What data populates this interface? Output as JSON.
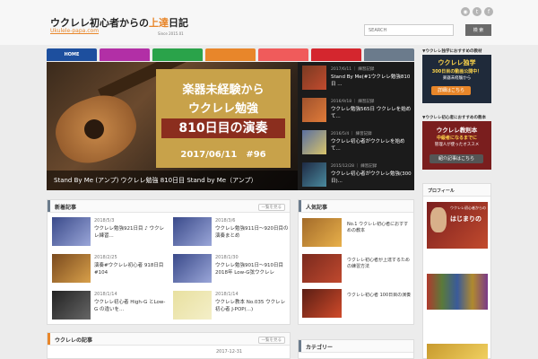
{
  "site": {
    "title_pre": "ウクレレ初心者からの",
    "title_accent": "上達",
    "title_post": "日記",
    "subtitle": "Ukulele-papa.com",
    "since": "Since 2015.01"
  },
  "social_icons": [
    "rss-icon",
    "twitter-icon",
    "facebook-icon"
  ],
  "search": {
    "placeholder": "SEARCH",
    "button": "検 索"
  },
  "nav": [
    {
      "label": "HOME",
      "color": "#1d4f9e"
    },
    {
      "label": "",
      "color": "#b22fa6"
    },
    {
      "label": "",
      "color": "#2aa34a"
    },
    {
      "label": "",
      "color": "#e8862a"
    },
    {
      "label": "",
      "color": "#f05b5b"
    },
    {
      "label": "",
      "color": "#d4262e"
    },
    {
      "label": "",
      "color": "#6b7b8c"
    }
  ],
  "hero": {
    "line1": "楽器未経験から",
    "line2": "ウクレレ勉強",
    "line3": "810日目の演奏",
    "line4": "2017/06/11　#96",
    "caption": "Stand By Me (アンプ) ウクレレ勉強 810日目 Stand by Me（アンプ）",
    "list": [
      {
        "date": "2017/6/11 ｜ 練習記録",
        "title": "Stand By Me(#1ウクレレ勉強810日 ..."
      },
      {
        "date": "2016/9/18 ｜ 練習記録",
        "title": "ウクレレ勉強565日 ウクレレを始めて..."
      },
      {
        "date": "2016/5/4 ｜ 練習記録",
        "title": "ウクレレ初心者がウクレレを始めて..."
      },
      {
        "date": "2015/12/28 ｜ 練習記録",
        "title": "ウクレレ初心者がウクレレ勉強(300日)..."
      }
    ]
  },
  "new_posts": {
    "title": "新着記事",
    "more": "一覧を見る",
    "items": [
      {
        "date": "2018/5/3",
        "title": "ウクレレ勉強921日目 ♪ ウクレレ練習..."
      },
      {
        "date": "2018/3/6",
        "title": "ウクレレ勉強911日～920日目の演奏まとめ"
      },
      {
        "date": "2018/2/25",
        "title": "演奏#ウクレレ初心者 918日目 #104"
      },
      {
        "date": "2018/1/30",
        "title": "ウクレレ勉強901日～910日目 2018年 Low-G弦ウクレレ"
      },
      {
        "date": "2018/1/14",
        "title": "ウクレレ初心者 High-G とLow-G の違いを..."
      },
      {
        "date": "2018/1/14",
        "title": "ウクレレ教本 No.035 ウクレレ初心者 J-POP(...)"
      }
    ]
  },
  "popular": {
    "title": "人気記事",
    "items": [
      {
        "title": "No.1 ウクレレ初心者におすすめの教本"
      },
      {
        "title": "ウクレレ初心者が上達するための練習方法"
      },
      {
        "title": "ウクレレ初心者 100日目の演奏"
      },
      {
        "title": "ウクレレ勉強 10日目～100日目の演奏"
      }
    ]
  },
  "bottom_left_title": "ウクレレの記事",
  "bottom_left_date": "2017-12-31",
  "bottom_right_title": "カテゴリー",
  "sidebar": {
    "label1": "▼ウクレレ独学におすすめの教材",
    "banner1": {
      "l1": "ウクレレ独学",
      "l2": "300日目の動画公開中！",
      "l3": "楽器未経験から",
      "btn": "詳細はこちら"
    },
    "label2": "▼ウクレレ初心者におすすめの教本",
    "banner2": {
      "l1": "ウクレレ教則本",
      "l2": "中級者になるまでに",
      "l3": "管理人が使ったオススメ",
      "btn": "紹介記事はこちら"
    },
    "panel_title": "プロフィール",
    "profile_text": "はじまりの",
    "profile_badge": "ウクレレ初心者からの"
  }
}
